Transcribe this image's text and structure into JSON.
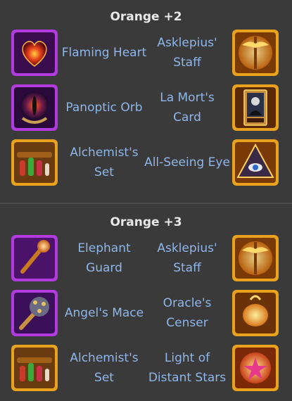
{
  "sections": [
    {
      "title": "Orange +2",
      "rows": [
        {
          "left": {
            "label": "Flaming Heart",
            "icon": "flaming-heart-icon"
          },
          "right": {
            "label": "Asklepius' Staff",
            "icon": "asklepius-staff-icon"
          }
        },
        {
          "left": {
            "label": "Panoptic Orb",
            "icon": "panoptic-orb-icon"
          },
          "right": {
            "label": "La Mort's Card",
            "icon": "la-mort-card-icon"
          }
        },
        {
          "left": {
            "label": "Alchemist's Set",
            "icon": "alchemist-set-icon"
          },
          "right": {
            "label": "All-Seeing Eye",
            "icon": "all-seeing-eye-icon"
          }
        }
      ]
    },
    {
      "title": "Orange +3",
      "rows": [
        {
          "left": {
            "label": "Elephant Guard",
            "icon": "elephant-guard-icon"
          },
          "right": {
            "label": "Asklepius' Staff",
            "icon": "asklepius-staff-icon"
          }
        },
        {
          "left": {
            "label": "Angel's Mace",
            "icon": "angel-mace-icon"
          },
          "right": {
            "label": "Oracle's Censer",
            "icon": "oracle-censer-icon"
          }
        },
        {
          "left": {
            "label": "Alchemist's Set",
            "icon": "alchemist-set-icon"
          },
          "right": {
            "label": "Light of Distant Stars",
            "icon": "light-of-distant-stars-icon"
          }
        }
      ]
    }
  ],
  "colors": {
    "background": "#3a3a3a",
    "title": "#e8e8e8",
    "label": "#8fb6ea",
    "purple_frame": "#b23be0",
    "gold_frame": "#e8a21e"
  }
}
